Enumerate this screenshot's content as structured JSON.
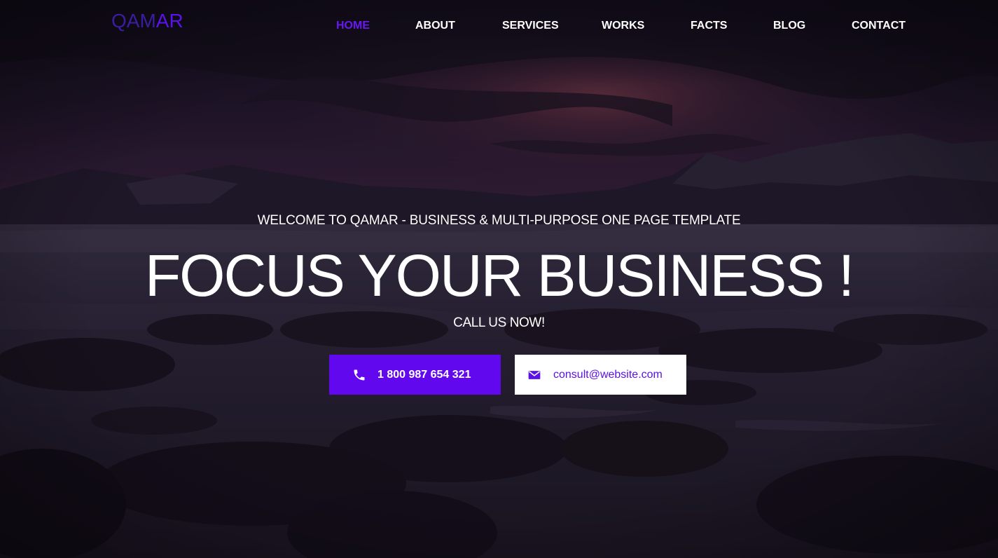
{
  "brand": {
    "logo_part1": "QAM",
    "logo_part2": "AR"
  },
  "nav": {
    "items": [
      {
        "label": "HOME",
        "active": true
      },
      {
        "label": "ABOUT",
        "active": false
      },
      {
        "label": "SERVICES",
        "active": false
      },
      {
        "label": "WORKS",
        "active": false
      },
      {
        "label": "FACTS",
        "active": false
      },
      {
        "label": "BLOG",
        "active": false
      },
      {
        "label": "CONTACT",
        "active": false
      }
    ]
  },
  "hero": {
    "welcome": "WELCOME TO QAMAR - BUSINESS & MULTI-PURPOSE ONE PAGE TEMPLATE",
    "headline": "FOCUS YOUR BUSINESS !",
    "subline": "CALL US NOW!",
    "phone_button": {
      "label": "1 800 987 654 321",
      "icon": "phone-icon"
    },
    "email_button": {
      "label": "consult@website.com",
      "icon": "envelope-icon"
    }
  },
  "colors": {
    "accent": "#6108ee",
    "active_nav": "#6a18f0",
    "text": "#ffffff"
  }
}
